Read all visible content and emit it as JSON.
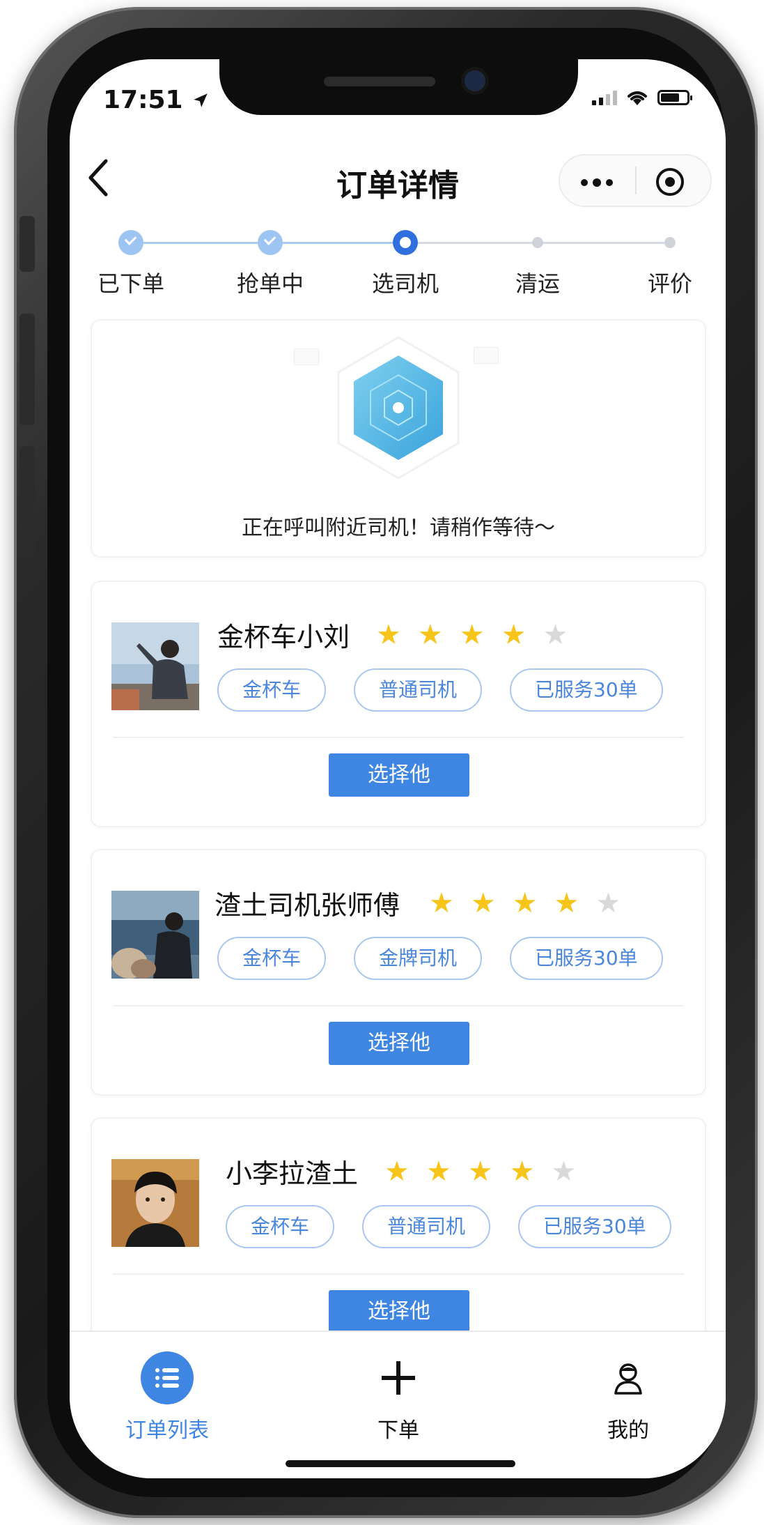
{
  "status_bar": {
    "time": "17:51"
  },
  "nav": {
    "title": "订单详情"
  },
  "steps": [
    {
      "label": "已下单",
      "state": "done"
    },
    {
      "label": "抢单中",
      "state": "done"
    },
    {
      "label": "选司机",
      "state": "current"
    },
    {
      "label": "清运",
      "state": "pending"
    },
    {
      "label": "评价",
      "state": "pending"
    }
  ],
  "radar": {
    "message": "正在呼叫附近司机！请稍作等待～"
  },
  "drivers": [
    {
      "name": "金杯车小刘",
      "rating": 4,
      "max_rating": 5,
      "tags": [
        "金杯车",
        "普通司机",
        "已服务30单"
      ],
      "select_label": "选择他"
    },
    {
      "name": "渣土司机张师傅",
      "rating": 4,
      "max_rating": 5,
      "tags": [
        "金杯车",
        "金牌司机",
        "已服务30单"
      ],
      "select_label": "选择他"
    },
    {
      "name": "小李拉渣土",
      "rating": 4,
      "max_rating": 5,
      "tags": [
        "金杯车",
        "普通司机",
        "已服务30单"
      ],
      "select_label": "选择他"
    }
  ],
  "tab_bar": {
    "items": [
      {
        "label": "订单列表",
        "icon": "list-icon",
        "active": true
      },
      {
        "label": "下单",
        "icon": "plus-icon",
        "active": false
      },
      {
        "label": "我的",
        "icon": "user-icon",
        "active": false
      }
    ]
  },
  "colors": {
    "accent": "#3f86e2",
    "star_on": "#f6c41a",
    "star_off": "#d9d9d9",
    "step_done": "#9ec5f2",
    "step_current": "#2f6fde"
  }
}
